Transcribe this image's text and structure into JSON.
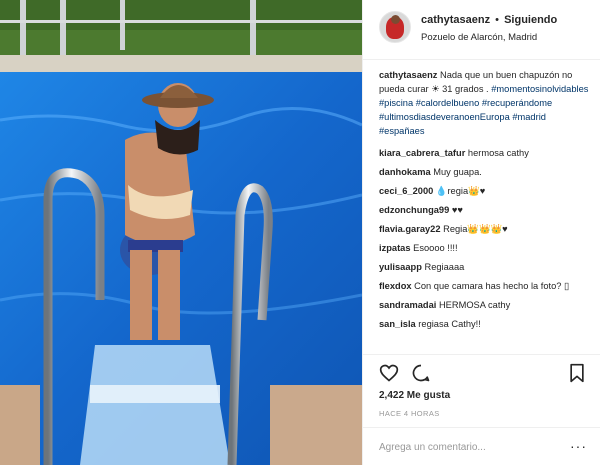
{
  "post": {
    "photo_description_icon": "pool-photo",
    "header": {
      "username": "cathytasaenz",
      "separator": "•",
      "follow_status": "Siguiendo",
      "location": "Pozuelo de Alarcón, Madrid"
    },
    "caption": {
      "username": "cathytasaenz",
      "text": "Nada que un buen chapuzón no pueda curar ☀ 31 grados .",
      "hashtags": "#momentosinolvidables #piscina #calordelbueno #recuperándome #ultimosdiasdeveranoenEuropa #madrid #españaes"
    },
    "comments": [
      {
        "user": "kiara_cabrera_tafur",
        "text": "hermosa cathy"
      },
      {
        "user": "danhokama",
        "text": "Muy guapa."
      },
      {
        "user": "ceci_6_2000",
        "text": "💧regia👑♥"
      },
      {
        "user": "edzonchunga99",
        "text": "♥♥"
      },
      {
        "user": "flavia.garay22",
        "text": "Regia👑👑👑♥"
      },
      {
        "user": "izpatas",
        "text": "Esoooo !!!!"
      },
      {
        "user": "yulisaapp",
        "text": "Regiaaaa"
      },
      {
        "user": "flexdox",
        "text": "Con que camara has hecho la foto? ▯"
      },
      {
        "user": "sandramadai",
        "text": "HERMOSA cathy"
      },
      {
        "user": "san_isla",
        "text": "regiasa Cathy!!"
      }
    ],
    "likes": "2,422 Me gusta",
    "time": "HACE 4 HORAS",
    "add_comment_placeholder": "Agrega un comentario...",
    "more_label": "···"
  },
  "colors": {
    "hashtag": "#003569",
    "pool": "#1b6fd1",
    "border": "#efefef"
  }
}
